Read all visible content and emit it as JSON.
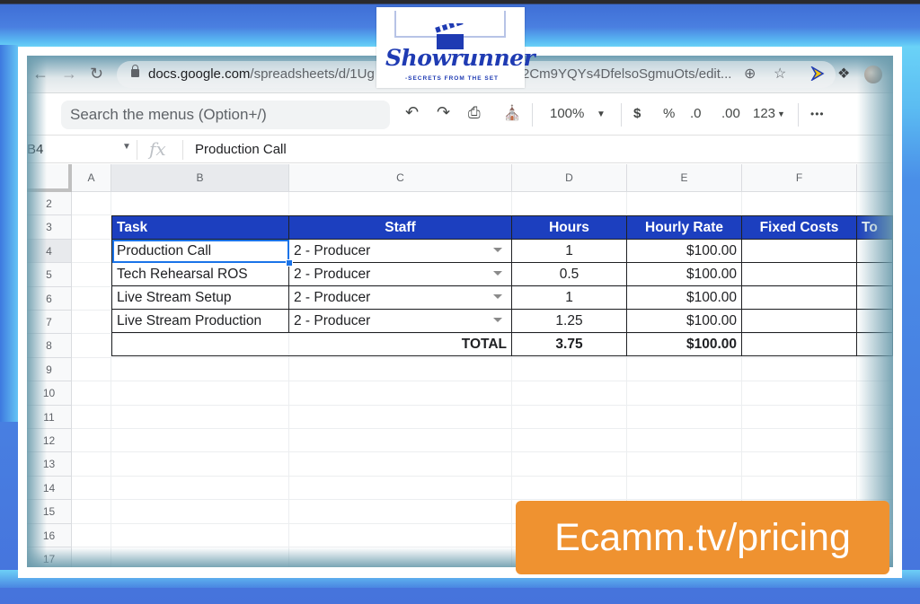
{
  "browser": {
    "url_domain": "docs.google.com",
    "url_path_start": "/spreadsheets/d/1Ug",
    "url_path_end": "2Cm9YQYs4DfelsoSgmuOts/edit..."
  },
  "toolbar": {
    "search_placeholder": "Search the menus (Option+/)",
    "zoom": "100%",
    "currency": "$",
    "percent": "%",
    "decrease_decimal": ".0",
    "increase_decimal": ".00",
    "number_format": "123",
    "more": "•••"
  },
  "formula_bar": {
    "cell_ref": "B4",
    "fx": "fx",
    "value": "Production Call"
  },
  "columns": [
    "A",
    "B",
    "C",
    "D",
    "E",
    "F"
  ],
  "rows": [
    "2",
    "3",
    "4",
    "5",
    "6",
    "7",
    "8",
    "9",
    "10",
    "11",
    "12",
    "13",
    "14",
    "15",
    "16",
    "17"
  ],
  "table": {
    "headers": [
      "Task",
      "Staff",
      "Hours",
      "Hourly Rate",
      "Fixed Costs",
      "To"
    ],
    "rows": [
      {
        "task": "Production Call",
        "staff": "2 - Producer",
        "hours": "1",
        "rate": "$100.00",
        "fixed": ""
      },
      {
        "task": "Tech Rehearsal ROS",
        "staff": "2 - Producer",
        "hours": "0.5",
        "rate": "$100.00",
        "fixed": ""
      },
      {
        "task": "Live Stream Setup",
        "staff": "2 - Producer",
        "hours": "1",
        "rate": "$100.00",
        "fixed": ""
      },
      {
        "task": "Live Stream Production",
        "staff": "2 - Producer",
        "hours": "1.25",
        "rate": "$100.00",
        "fixed": ""
      }
    ],
    "total": {
      "label": "TOTAL",
      "hours": "3.75",
      "rate": "$100.00",
      "fixed": ""
    }
  },
  "overlay": {
    "logo_title": "Showrunner",
    "logo_tagline": "-SECRETS FROM THE SET",
    "promo_text": "Ecamm.tv/pricing"
  },
  "colors": {
    "header_blue": "#1c3fbf",
    "promo_orange": "#ef9230",
    "selection_blue": "#1a73e8"
  }
}
